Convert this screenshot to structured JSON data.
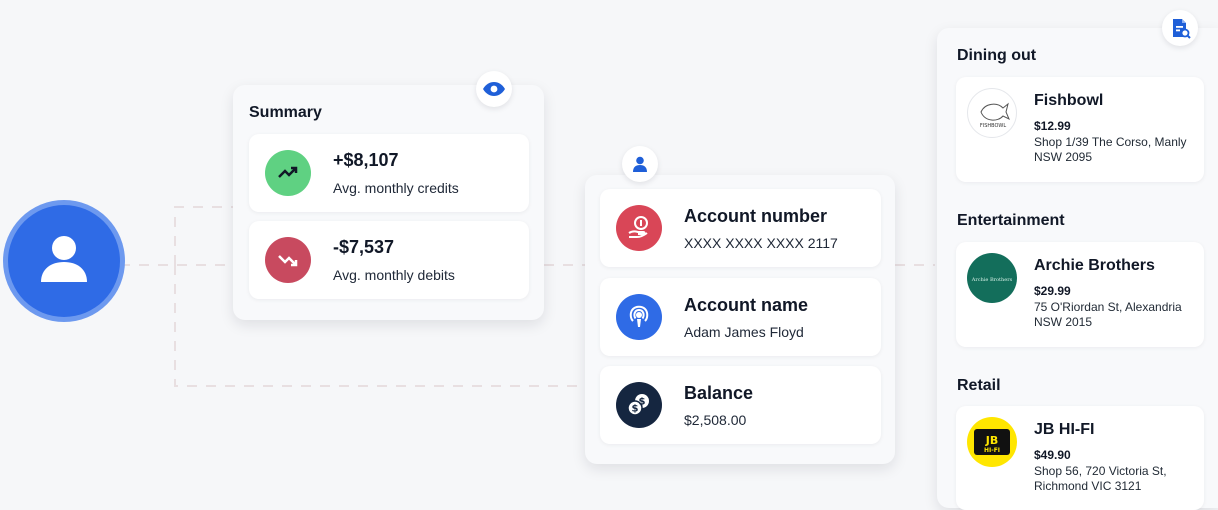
{
  "summary": {
    "title": "Summary",
    "credits": {
      "amount": "+$8,107",
      "label": "Avg. monthly credits",
      "icon": "trending-up-icon",
      "color": "#5fd182"
    },
    "debits": {
      "amount": "-$7,537",
      "label": "Avg. monthly debits",
      "icon": "trending-down-icon",
      "color": "#c84a5f"
    }
  },
  "account": {
    "number": {
      "title": "Account number",
      "value": "XXXX XXXX XXXX 2117",
      "icon": "hand-coin-icon",
      "color": "#d94657"
    },
    "name": {
      "title": "Account name",
      "value": "Adam James Floyd",
      "icon": "podcast-icon",
      "color": "#2f6be6"
    },
    "balance": {
      "title": "Balance",
      "value": "$2,508.00",
      "icon": "coins-icon",
      "color": "#152640"
    }
  },
  "spending": {
    "dining": {
      "title": "Dining out",
      "merchant": "Fishbowl",
      "price": "$12.99",
      "address": "Shop 1/39 The Corso, Manly NSW 2095",
      "logo_text": "FISHBOWL"
    },
    "entertainment": {
      "title": "Entertainment",
      "merchant": "Archie Brothers",
      "price": "$29.99",
      "address": "75 O'Riordan St, Alexandria NSW 2015",
      "logo_text": "Archie Brothers"
    },
    "retail": {
      "title": "Retail",
      "merchant": "JB HI-FI",
      "price": "$49.90",
      "address": "Shop 56, 720 Victoria St, Richmond VIC 3121",
      "logo_text": "JB HI-FI"
    }
  },
  "icons": {
    "avatar": "user-icon",
    "summary_badge": "eye-icon",
    "account_badge": "user-icon",
    "spending_badge": "document-search-icon"
  }
}
